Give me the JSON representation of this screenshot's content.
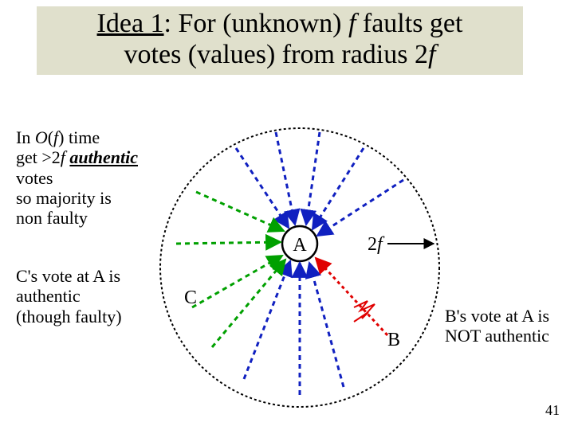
{
  "title": {
    "idea_prefix": "Idea 1",
    "rest_line1": ": For (unknown) ",
    "f1": "f",
    "after_f1": " faults get",
    "line2a": "votes (values) from radius 2",
    "f2": "f"
  },
  "left1": {
    "l1a": "In ",
    "l1b": "O",
    "l1c": "(",
    "l1d": "f",
    "l1e": ") time",
    "l2a": "get >2",
    "l2b": "f",
    "l2c": "  ",
    "l2d": "authentic",
    "l3": "votes",
    "l4": "so majority is",
    "l5": "non faulty"
  },
  "left2": {
    "l1": "C's vote at A is",
    "l2": "authentic",
    "l3": "(though faulty)"
  },
  "right": {
    "l1": "B's vote at A is",
    "l2": "NOT authentic"
  },
  "labels": {
    "A": "A",
    "B": "B",
    "C": "C",
    "twoF": "2",
    "twoF_f": "f"
  },
  "slide_number": "41",
  "colors": {
    "title_bg": "#e0e0cc",
    "blue": "#1020c0",
    "green": "#00a000",
    "red": "#e00000",
    "black": "#000000"
  }
}
